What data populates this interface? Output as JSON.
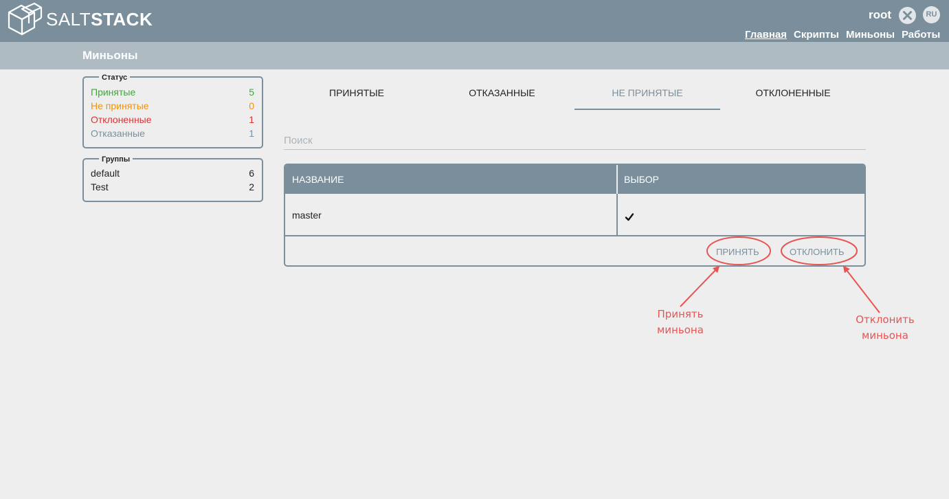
{
  "header": {
    "brand_light": "SALT",
    "brand_bold": "STACK",
    "user": "root",
    "lang": "RU",
    "nav": [
      "Главная",
      "Скрипты",
      "Миньоны",
      "Работы"
    ]
  },
  "page_title": "Миньоны",
  "status": {
    "legend": "Статус",
    "items": [
      {
        "label": "Принятые",
        "count": "5",
        "color": "#3aaa35"
      },
      {
        "label": "Не принятые",
        "count": "0",
        "color": "#f0940a"
      },
      {
        "label": "Отклоненные",
        "count": "1",
        "color": "#e03030"
      },
      {
        "label": "Отказанные",
        "count": "1",
        "color": "#7a8f9b"
      }
    ]
  },
  "groups": {
    "legend": "Группы",
    "items": [
      {
        "label": "default",
        "count": "6"
      },
      {
        "label": "Test",
        "count": "2"
      }
    ]
  },
  "tabs": [
    "ПРИНЯТЫЕ",
    "ОТКАЗАННЫЕ",
    "НЕ ПРИНЯТЫЕ",
    "ОТКЛОНЕННЫЕ"
  ],
  "active_tab": "НЕ ПРИНЯТЫЕ",
  "search": {
    "placeholder": "Поиск",
    "value": ""
  },
  "table": {
    "columns": [
      "НАЗВАНИЕ",
      "ВЫБОР"
    ],
    "rows": [
      {
        "name": "master",
        "selected": true
      }
    ],
    "actions": {
      "accept": "ПРИНЯТЬ",
      "reject": "ОТКЛОНИТЬ"
    }
  },
  "annotations": {
    "accept_note": [
      "Принять",
      "миньона"
    ],
    "reject_note": [
      "Отклонить",
      "миньона"
    ],
    "color": "#e85454"
  }
}
